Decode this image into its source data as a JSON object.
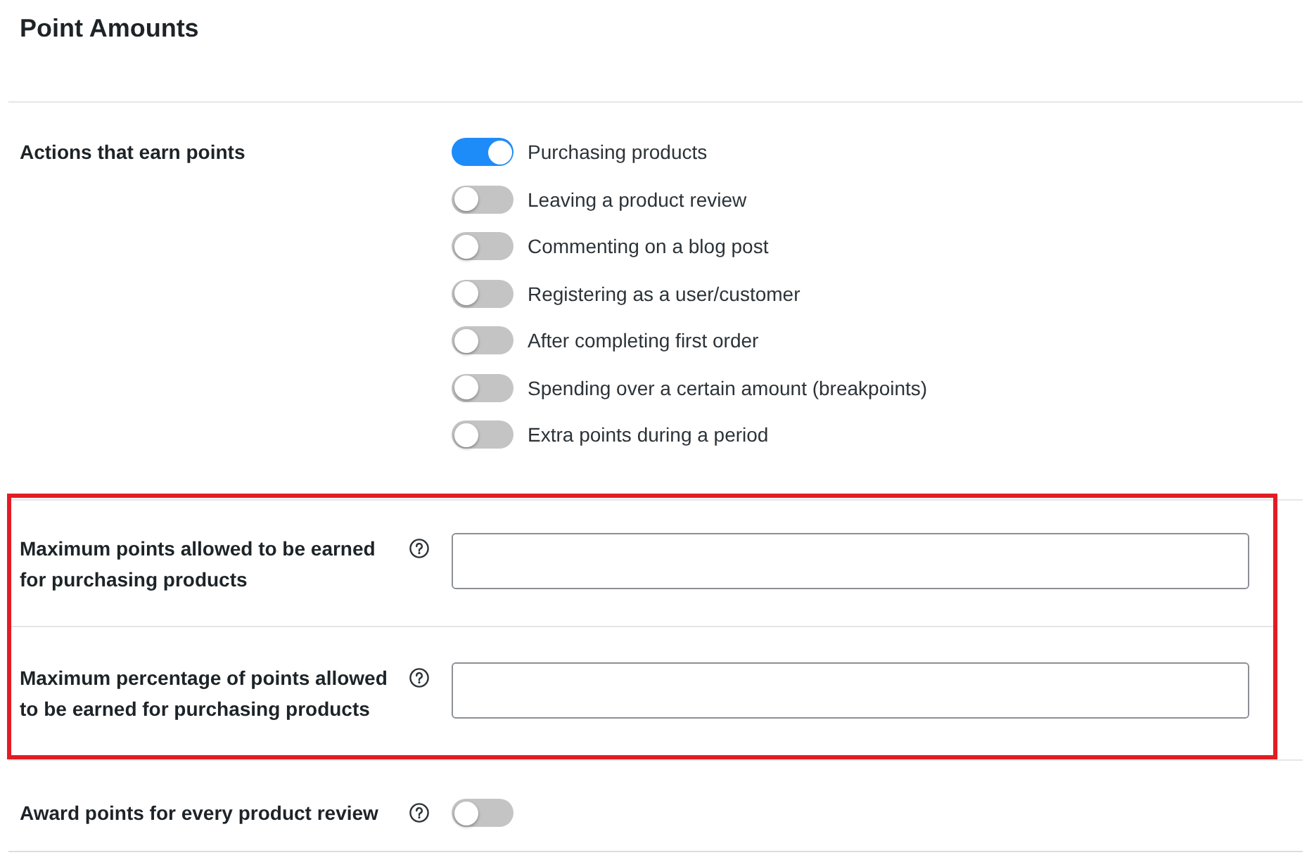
{
  "page": {
    "title": "Point Amounts"
  },
  "settings": [
    {
      "kind": "toggle_group",
      "label": "Actions that earn points",
      "help_icon": false,
      "highlighted": false,
      "options": [
        {
          "label": "Purchasing products",
          "on": true
        },
        {
          "label": "Leaving a product review",
          "on": false
        },
        {
          "label": "Commenting on a blog post",
          "on": false
        },
        {
          "label": "Registering as a user/customer",
          "on": false
        },
        {
          "label": "After completing first order",
          "on": false
        },
        {
          "label": "Spending over a certain amount (breakpoints)",
          "on": false
        },
        {
          "label": "Extra points during a period",
          "on": false
        }
      ]
    },
    {
      "kind": "text_input",
      "label": "Maximum points allowed to be earned for purchasing products",
      "help_icon": true,
      "highlighted": true
    },
    {
      "kind": "text_input",
      "label": "Maximum percentage of points allowed to be earned for purchasing products",
      "help_icon": true,
      "highlighted": true
    },
    {
      "kind": "toggle",
      "label": "Award points for every product review",
      "help_icon": true,
      "highlighted": false,
      "on": false
    }
  ]
}
